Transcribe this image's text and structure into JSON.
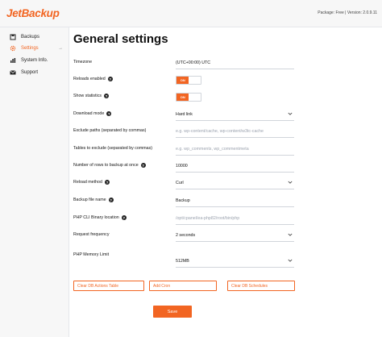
{
  "header": {
    "logo": "JetBackup",
    "package_info": "Package: Free | Version: 2.0.9.11"
  },
  "sidebar": {
    "items": [
      {
        "label": "Backups",
        "icon": "backup-icon"
      },
      {
        "label": "Settings",
        "icon": "gear-icon",
        "active": true
      },
      {
        "label": "System Info.",
        "icon": "chart-icon"
      },
      {
        "label": "Support",
        "icon": "mail-icon"
      }
    ]
  },
  "main": {
    "title": "General settings",
    "fields": {
      "timezone": {
        "label": "Timezone",
        "value": "(UTC+00:00) UTC"
      },
      "reloads_enabled": {
        "label": "Reloads enabled",
        "value": "ON"
      },
      "show_statistics": {
        "label": "Show statistics",
        "value": "ON"
      },
      "download_mode": {
        "label": "Download mode",
        "value": "Hard link"
      },
      "exclude_paths": {
        "label": "Exclude paths (separated by commas)",
        "placeholder": "e.g. wp-content/cache, wp-content/w3tc-cache"
      },
      "tables_exclude": {
        "label": "Tables to exclude (separated by commas)",
        "placeholder": "e.g. wp_comments, wp_commentmeta"
      },
      "rows_once": {
        "label": "Number of rows to backup at once",
        "value": "10000"
      },
      "reload_method": {
        "label": "Reload method",
        "value": "Curl"
      },
      "backup_file_name": {
        "label": "Backup file name",
        "value": "Backup"
      },
      "php_cli": {
        "label": "PHP CLI Binary location",
        "placeholder": "/opt/cpanel/ea-php82/root/bin/php"
      },
      "request_frequency": {
        "label": "Request frequency",
        "value": "2 seconds"
      },
      "php_memory": {
        "label": "PHP Memory Limit",
        "value": "512MB"
      }
    },
    "buttons": {
      "clear_db_actions": "Clear DB Actions Table",
      "add_cron": "Add Cron",
      "clear_db_schedules": "Clear DB Schedules",
      "save": "Save"
    }
  },
  "colors": {
    "accent": "#f26522"
  }
}
